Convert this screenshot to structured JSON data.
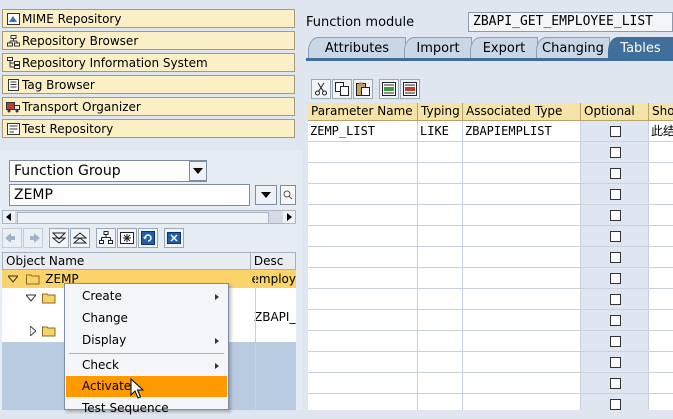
{
  "navigator": {
    "items": [
      {
        "label": "MIME Repository",
        "icon": "mime-icon"
      },
      {
        "label": "Repository Browser",
        "icon": "hierarchy-icon"
      },
      {
        "label": "Repository Information System",
        "icon": "info-system-icon"
      },
      {
        "label": "Tag Browser",
        "icon": "tag-icon"
      },
      {
        "label": "Transport Organizer",
        "icon": "truck-icon"
      },
      {
        "label": "Test Repository",
        "icon": "test-icon"
      }
    ]
  },
  "object_selector": {
    "type_value": "Function Group",
    "name_value": "ZEMP"
  },
  "tree": {
    "headers": [
      "Object Name",
      "Desc"
    ],
    "rows": [
      {
        "name": "ZEMP",
        "desc": "employ"
      },
      {
        "name": "",
        "desc": ""
      },
      {
        "name": "",
        "desc": "ZBAPI_"
      }
    ]
  },
  "context_menu": {
    "items": [
      {
        "label": "Create",
        "submenu": true
      },
      {
        "label": "Change",
        "submenu": false
      },
      {
        "label": "Display",
        "submenu": true
      },
      {
        "label": "Check",
        "submenu": true
      },
      {
        "label": "Activate",
        "submenu": false,
        "highlighted": true
      },
      {
        "label": "Test Sequence",
        "submenu": false
      }
    ]
  },
  "function_module": {
    "label": "Function module",
    "value": "ZBAPI_GET_EMPLOYEE_LIST"
  },
  "tabs": [
    {
      "label": "Attributes",
      "active": false
    },
    {
      "label": "Import",
      "active": false
    },
    {
      "label": "Export",
      "active": false
    },
    {
      "label": "Changing",
      "active": false
    },
    {
      "label": "Tables",
      "active": true
    }
  ],
  "table": {
    "headers": [
      "Parameter Name",
      "Typing",
      "Associated Type",
      "Optional",
      "Sho"
    ],
    "rows": [
      {
        "param": "ZEMP_LIST",
        "typing": "LIKE",
        "assoc": "ZBAPIEMPLIST",
        "optional": false,
        "short": "此结"
      }
    ],
    "empty_rows": 13
  },
  "colors": {
    "navigator_bg": "#fbefc6",
    "header_bg": "#f5e3a8",
    "active_tab": "#3f6f9a",
    "menu_highlight": "#ff9900",
    "tree_selected": "#fbd36b"
  }
}
